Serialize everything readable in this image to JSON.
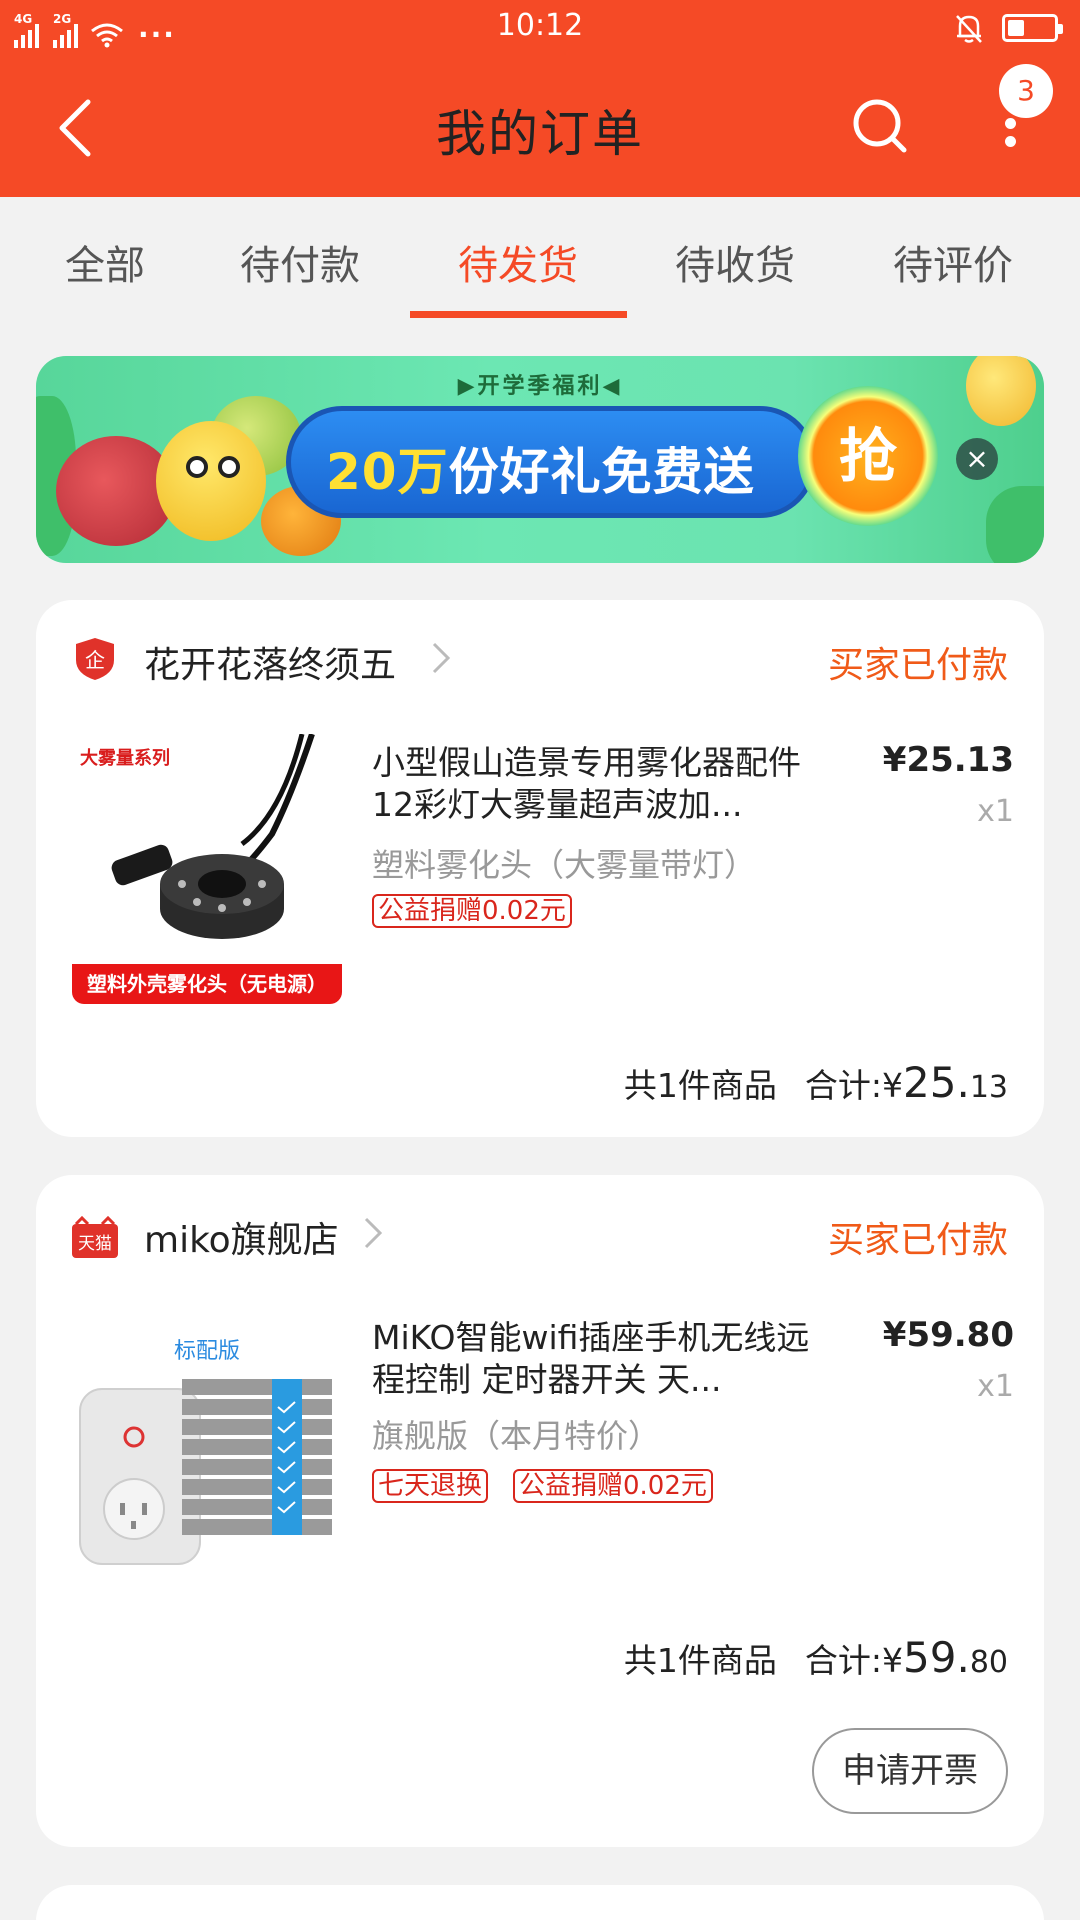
{
  "status_bar": {
    "signal1": "4G",
    "signal2": "2G",
    "dots": "···",
    "time": "10:12"
  },
  "header": {
    "title": "我的订单",
    "badge_count": "3"
  },
  "tabs": [
    {
      "label": "全部"
    },
    {
      "label": "待付款"
    },
    {
      "label": "待发货"
    },
    {
      "label": "待收货"
    },
    {
      "label": "待评价"
    }
  ],
  "active_tab": 2,
  "banner": {
    "top_text": "开学季福利",
    "main_prefix": "20万",
    "main_text": "份好礼免费送",
    "grab": "抢",
    "close": "×"
  },
  "orders": [
    {
      "shop_badge": "企",
      "shop_name": "花开花落终须五",
      "status": "买家已付款",
      "thumb_top": "大雾量系列",
      "thumb_bottom": "塑料外壳雾化头（无电源）",
      "title": "小型假山造景专用雾化器配件12彩灯大雾量超声波加...",
      "sku": "塑料雾化头（大雾量带灯）",
      "tags": [
        "公益捐赠0.02元"
      ],
      "price": "¥25.13",
      "qty": "x1",
      "count_text": "共1件商品",
      "total_label": "合计: ",
      "total_symbol": "¥",
      "total_int": "25.",
      "total_dec": "13"
    },
    {
      "shop_badge": "天猫",
      "shop_name": "miko旗舰店",
      "status": "买家已付款",
      "thumb_top": "标配版",
      "title": "MiKO智能wifi插座手机无线远程控制 定时器开关 天...",
      "sku": "旗舰版（本月特价）",
      "tags": [
        "七天退换",
        "公益捐赠0.02元"
      ],
      "price": "¥59.80",
      "qty": "x1",
      "count_text": "共1件商品",
      "total_label": "合计: ",
      "total_symbol": "¥",
      "total_int": "59.",
      "total_dec": "80",
      "action_button": "申请开票"
    }
  ],
  "colors": {
    "brand": "#f54a26",
    "status_orange": "#f05a18",
    "tag_red": "#d9261c"
  }
}
